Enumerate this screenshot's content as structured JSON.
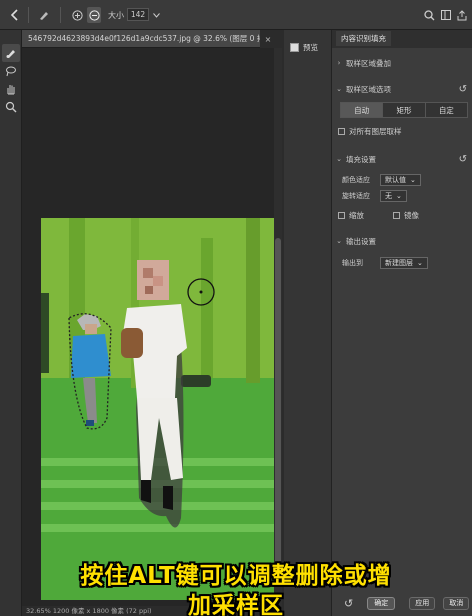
{
  "toolbar": {
    "size_label": "大小",
    "size_value": "142"
  },
  "document": {
    "tab_title": "546792d4623893d4e0f126d1a9cdc537.jpg @ 32.6% (图层 0 拷...",
    "close_glyph": "×",
    "status": "32.65%    1200 像素 x 1800 像素 (72 ppi)"
  },
  "preview": {
    "label": "预览"
  },
  "panel": {
    "title": "内容识别填充",
    "sampling_overlay": "取样区域叠加",
    "sampling_options": "取样区域选项",
    "modes": [
      {
        "label": "自动",
        "active": true
      },
      {
        "label": "矩形",
        "active": false
      },
      {
        "label": "自定",
        "active": false
      }
    ],
    "sample_all_layers": "对所有图层取样",
    "fill_settings": "填充设置",
    "color_adapt_label": "颜色适应",
    "color_adapt_value": "默认值",
    "rotation_adapt_label": "旋转适应",
    "rotation_adapt_value": "无",
    "scale_label": "缩放",
    "mirror_label": "镜像",
    "output_settings": "输出设置",
    "output_to_label": "输出到",
    "output_to_value": "新建图层"
  },
  "buttons": {
    "ok": "确定",
    "apply": "应用",
    "cancel": "取消"
  },
  "subtitle": {
    "line1": "按住ALT键可以调整删除或增",
    "line2": "加采样区"
  },
  "colors": {
    "overlay_green": "#5cbf3a",
    "subtitle_yellow": "#ffe000"
  }
}
